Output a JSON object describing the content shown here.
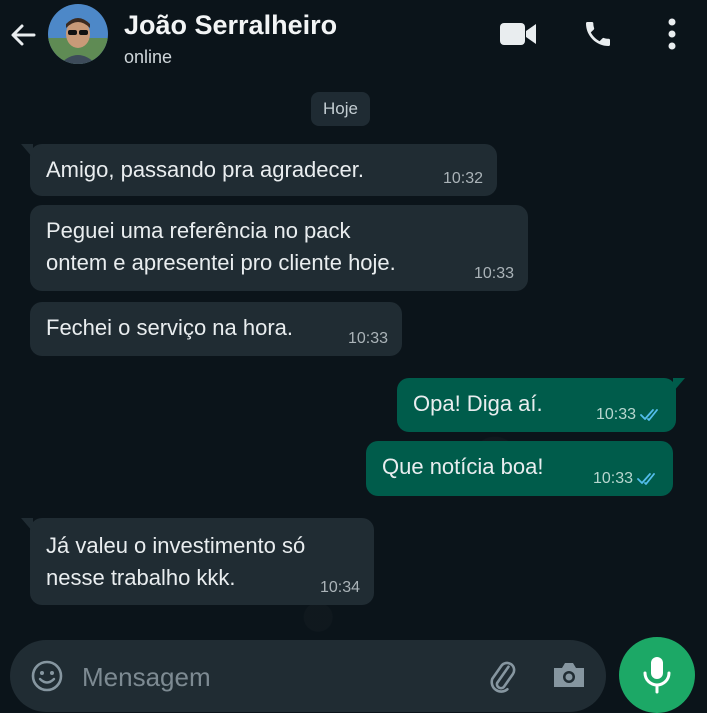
{
  "header": {
    "title": "João Serralheiro",
    "status": "online",
    "icons": [
      "back-arrow-icon",
      "video-call-icon",
      "phone-icon",
      "more-options-icon"
    ]
  },
  "chat": {
    "date_chip": "Hoje",
    "messages": [
      {
        "direction": "in",
        "text": "Amigo, passando pra agradecer.",
        "time": "10:32"
      },
      {
        "direction": "in",
        "text": "Peguei uma referência no pack\nontem e apresentei pro cliente hoje.",
        "time": "10:33"
      },
      {
        "direction": "in",
        "text": "Fechei o serviço na hora.",
        "time": "10:33"
      },
      {
        "direction": "out",
        "text": "Opa! Diga aí.",
        "time": "10:33",
        "read": true
      },
      {
        "direction": "out",
        "text": "Que notícia boa!",
        "time": "10:33",
        "read": true
      },
      {
        "direction": "in",
        "text": "Já valeu o investimento só\nnesse trabalho kkk.",
        "time": "10:34"
      }
    ]
  },
  "composer": {
    "placeholder": "Mensagem",
    "icons": [
      "emoji-icon",
      "attach-icon",
      "camera-icon",
      "microphone-icon"
    ]
  },
  "colors": {
    "background": "#0b141a",
    "incoming_bubble": "#202c33",
    "outgoing_bubble": "#005c4b",
    "read_ticks": "#53bdeb",
    "mic_button": "#1ca866"
  }
}
